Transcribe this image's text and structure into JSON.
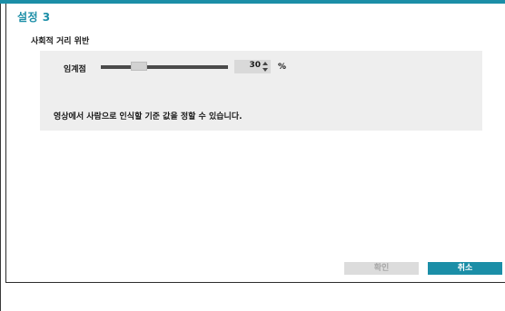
{
  "dialog": {
    "title": "설정 3",
    "section_heading": "사회적 거리 위반"
  },
  "threshold": {
    "label": "임계점",
    "value": "30",
    "unit": "%",
    "slider_fraction": 0.3
  },
  "description": "영상에서 사람으로 인식할 기준 값을 정할 수 있습니다.",
  "buttons": {
    "ok_label": "확인",
    "cancel_label": "취소"
  },
  "colors": {
    "accent": "#1b8ea7",
    "panel_bg": "#eeeeee",
    "disabled_button": "#dcdcdc"
  },
  "icons": {
    "spin_up": "chevron-up-icon",
    "spin_down": "chevron-down-icon"
  }
}
